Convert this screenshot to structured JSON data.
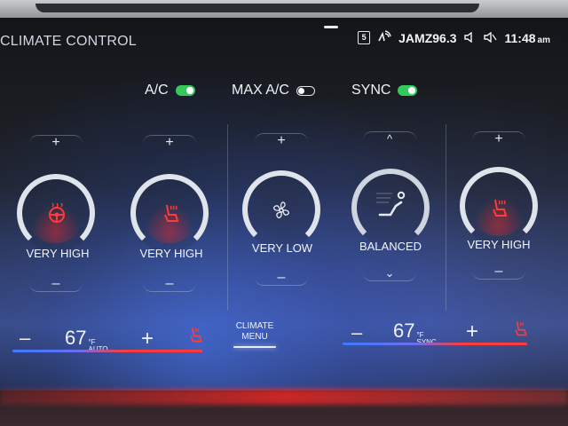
{
  "header": {
    "title": "CLIMATE CONTROL",
    "badge": "5",
    "radio_station": "JAMZ96.3",
    "time": "11:48",
    "time_suffix": "am"
  },
  "toggles": {
    "ac": {
      "label": "A/C",
      "state": "on"
    },
    "max_ac": {
      "label": "MAX A/C",
      "state": "off"
    },
    "sync": {
      "label": "SYNC",
      "state": "on"
    }
  },
  "controls": {
    "driver_heated_wheel": {
      "plus": "+",
      "minus": "–",
      "level": "VERY HIGH",
      "icon": "heated-steering-wheel-icon"
    },
    "driver_heated_seat": {
      "plus": "+",
      "minus": "–",
      "level": "VERY HIGH",
      "icon": "heated-seat-icon"
    },
    "fan": {
      "plus": "+",
      "minus": "–",
      "level": "VERY LOW",
      "icon": "fan-icon"
    },
    "airflow": {
      "up": "^",
      "down": "⌄",
      "level": "BALANCED",
      "icon": "seat-airflow-icon"
    },
    "passenger_heated_seat": {
      "plus": "+",
      "minus": "–",
      "level": "VERY HIGH",
      "icon": "heated-seat-icon"
    }
  },
  "bottom_bar": {
    "driver": {
      "minus": "–",
      "temp": "67",
      "unit": "°F",
      "mode": "AUTO",
      "plus": "+"
    },
    "menu": {
      "line1": "CLIMATE",
      "line2": "MENU"
    },
    "passenger": {
      "minus": "–",
      "temp": "67",
      "unit": "°F",
      "mode": "SYNC",
      "plus": "+"
    }
  },
  "colors": {
    "toggle_on": "#35c85a",
    "heat_red": "#ff3b3b",
    "cool_blue": "#3f7bff"
  }
}
